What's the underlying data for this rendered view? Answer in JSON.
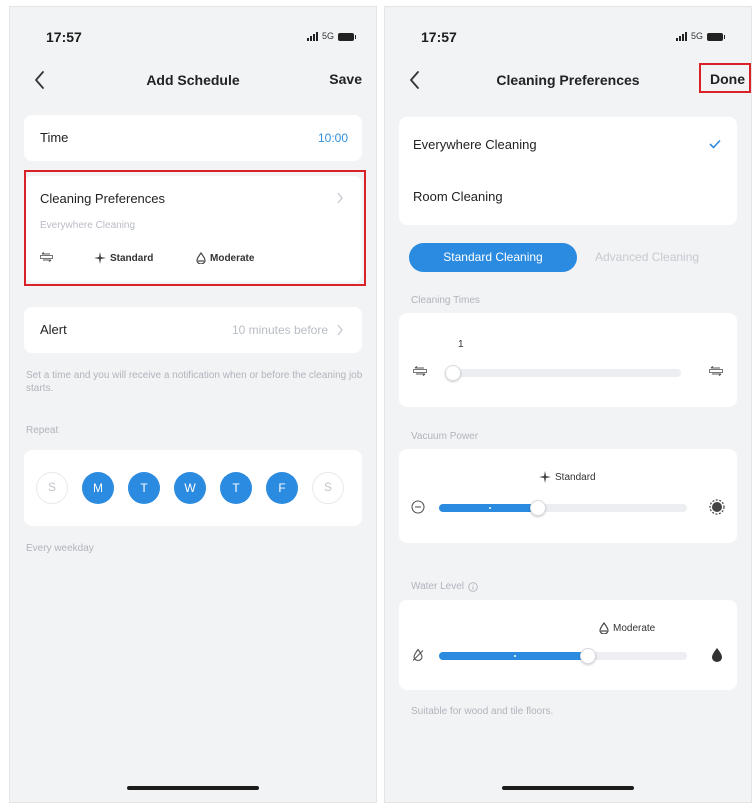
{
  "left_screen": {
    "status": {
      "time": "17:57",
      "network": "5G"
    },
    "nav": {
      "title": "Add Schedule",
      "action": "Save"
    },
    "time_row": {
      "label": "Time",
      "value": "10:00"
    },
    "preferences": {
      "title": "Cleaning Preferences",
      "subtitle": "Everywhere Cleaning",
      "chips": [
        {
          "icon": "cleaning-times-icon",
          "label": ""
        },
        {
          "icon": "fan-icon",
          "label": "Standard"
        },
        {
          "icon": "water-drop-icon",
          "label": "Moderate"
        }
      ]
    },
    "alert_row": {
      "label": "Alert",
      "value": "10 minutes before"
    },
    "alert_note": "Set a time and you will receive a notification when or before the cleaning job starts.",
    "repeat_label": "Repeat",
    "days": [
      {
        "label": "S",
        "selected": false
      },
      {
        "label": "M",
        "selected": true
      },
      {
        "label": "T",
        "selected": true
      },
      {
        "label": "W",
        "selected": true
      },
      {
        "label": "T",
        "selected": true
      },
      {
        "label": "F",
        "selected": true
      },
      {
        "label": "S",
        "selected": false
      }
    ],
    "repeat_summary": "Every weekday"
  },
  "right_screen": {
    "status": {
      "time": "17:57",
      "network": "5G"
    },
    "nav": {
      "title": "Cleaning Preferences",
      "action": "Done"
    },
    "mode_options": [
      {
        "label": "Everywhere Cleaning",
        "selected": true
      },
      {
        "label": "Room Cleaning",
        "selected": false
      }
    ],
    "tabs": {
      "active": "Standard Cleaning",
      "inactive": "Advanced Cleaning"
    },
    "cleaning_times": {
      "label": "Cleaning Times",
      "value": "1",
      "level": 0.0
    },
    "vacuum_power": {
      "label": "Vacuum Power",
      "value": "Standard",
      "level": 0.4
    },
    "water_level": {
      "label": "Water Level",
      "value": "Moderate",
      "level": 0.6
    },
    "floor_note": "Suitable for wood and tile floors."
  },
  "colors": {
    "accent": "#2b8be0",
    "highlight_box": "#d92128",
    "background": "#f2f3f5"
  }
}
